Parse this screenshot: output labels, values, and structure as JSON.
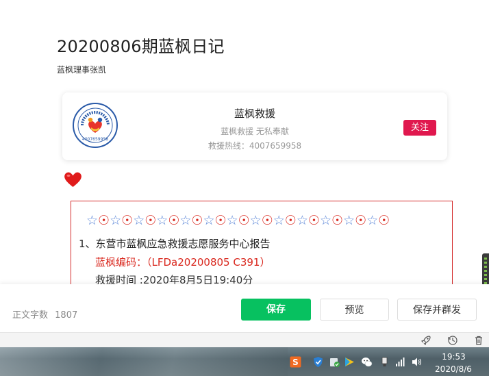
{
  "article": {
    "title": "20200806期蓝枫日记",
    "author": "蓝枫理事张凯"
  },
  "profile_card": {
    "logo_text": "4007659958",
    "name": "蓝枫救援",
    "description": "蓝枫救援 无私奉献",
    "hotline": "救援热线：4007659958",
    "follow_label": "关注"
  },
  "content": {
    "star_row": [
      "☆",
      "☉",
      "☆",
      "☉",
      "☆",
      "☉",
      "☆",
      "☉",
      "☆",
      "☉",
      "☆",
      "☉",
      "☆",
      "☉",
      "☆",
      "☉",
      "☆",
      "☉",
      "☆",
      "☉",
      "☆",
      "☉",
      "☆",
      "☉",
      "☆",
      "☉"
    ],
    "line1": "1、东营市蓝枫应急救援志愿服务中心报告",
    "line2": "蓝枫编码：（LFDa20200805 C391）",
    "line3": "救援时间 :2020年8月5日19:40分"
  },
  "footer": {
    "word_count_label": "正文字数",
    "word_count_value": "1807",
    "save_label": "保存",
    "preview_label": "预览",
    "publish_label": "保存并群发"
  },
  "taskbar": {
    "time": "19:53",
    "date": "2020/8/6",
    "tray_icons": [
      "sogou-ime-icon",
      "shield-icon",
      "security-check-icon",
      "media-play-icon",
      "wechat-icon",
      "usb-device-icon",
      "network-signal-icon",
      "volume-icon"
    ]
  },
  "colors": {
    "follow_red": "#e0184e",
    "save_green": "#07c160",
    "report_border": "#d42a2a",
    "star_blue": "#5c87d8"
  }
}
